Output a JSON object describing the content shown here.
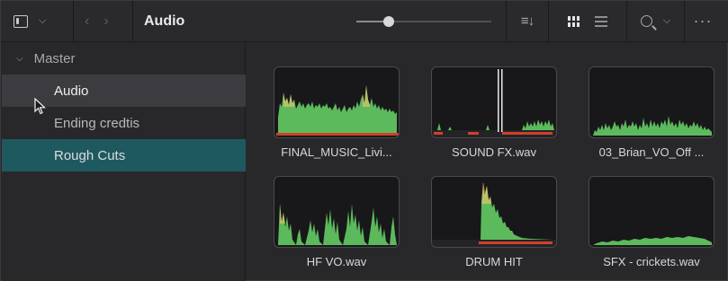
{
  "toolbar": {
    "title": "Audio",
    "panel_toggle_icon": "sidebar-panel-icon",
    "back_icon": "chevron-left-icon",
    "forward_icon": "chevron-right-icon",
    "zoom_slider_level": 0.24,
    "sort_icon": "sort-icon",
    "grid_view_icon": "grid-view-icon",
    "list_view_icon": "list-view-icon",
    "search_icon": "search-icon",
    "more_icon": "more-options-icon"
  },
  "sidebar": {
    "root": "Master",
    "items": [
      {
        "label": "Audio",
        "state": "selected"
      },
      {
        "label": "Ending credtis",
        "state": "normal"
      },
      {
        "label": "Rough Cuts",
        "state": "highlighted"
      }
    ]
  },
  "clips": [
    {
      "name": "FINAL_MUSIC_Livi...",
      "waveform": "music"
    },
    {
      "name": "SOUND FX.wav",
      "waveform": "sfx"
    },
    {
      "name": "03_Brian_VO_Off ...",
      "waveform": "vo"
    },
    {
      "name": "HF VO.wav",
      "waveform": "hfvo"
    },
    {
      "name": "DRUM HIT",
      "waveform": "drum"
    },
    {
      "name": "SFX - crickets.wav",
      "waveform": "crickets"
    }
  ],
  "colors": {
    "accent_teal": "#1e5960",
    "waveform_green": "#5cba5c",
    "waveform_yellow": "#c8c06a",
    "marker_red": "#d0402a"
  }
}
